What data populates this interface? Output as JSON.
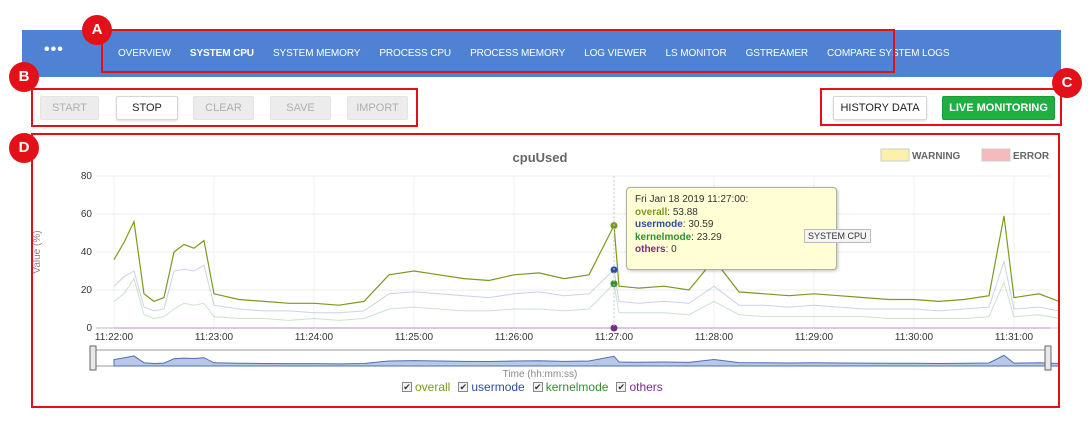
{
  "nav": {
    "more": "•••",
    "items": [
      {
        "label": "OVERVIEW",
        "active": false
      },
      {
        "label": "SYSTEM CPU",
        "active": true
      },
      {
        "label": "SYSTEM MEMORY",
        "active": false
      },
      {
        "label": "PROCESS CPU",
        "active": false
      },
      {
        "label": "PROCESS MEMORY",
        "active": false
      },
      {
        "label": "LOG VIEWER",
        "active": false
      },
      {
        "label": "LS MONITOR",
        "active": false
      },
      {
        "label": "GSTREAMER",
        "active": false
      },
      {
        "label": "COMPARE SYSTEM LOGS",
        "active": false
      }
    ]
  },
  "markers": {
    "a": "A",
    "b": "B",
    "c": "C",
    "d": "D"
  },
  "toolbar": {
    "start": "START",
    "stop": "STOP",
    "clear": "CLEAR",
    "save": "SAVE",
    "import": "IMPORT",
    "history": "HISTORY DATA",
    "live": "LIVE MONITORING"
  },
  "colors": {
    "accent": "#4f82d2",
    "annotation": "#e3101a",
    "live": "#1fae40",
    "overall": "#7a9a1e",
    "usermode": "#2a4f9c",
    "kernelmode": "#2f8f2f",
    "others": "#7b2a8a"
  },
  "chart_data": {
    "type": "line",
    "title": "cpuUsed",
    "ylabel": "Value (%)",
    "xlabel": "Time (hh:mm:ss)",
    "ylim": [
      0,
      80
    ],
    "y_ticks": [
      "0",
      "20",
      "40",
      "60",
      "80"
    ],
    "x_ticks": [
      "11:22:00",
      "11:23:00",
      "11:24:00",
      "11:25:00",
      "11:26:00",
      "11:27:00",
      "11:28:00",
      "11:29:00",
      "11:30:00",
      "11:31:00"
    ],
    "legend_top": [
      {
        "label": "WARNING",
        "color": "#fdf1a9"
      },
      {
        "label": "ERROR",
        "color": "#f8b9bd"
      }
    ],
    "x_minutes": [
      0,
      0.1,
      0.2,
      0.3,
      0.4,
      0.5,
      0.6,
      0.7,
      0.8,
      0.9,
      1.0,
      1.25,
      1.5,
      1.75,
      2.0,
      2.25,
      2.5,
      2.75,
      3.0,
      3.25,
      3.5,
      3.75,
      4.0,
      4.25,
      4.5,
      4.75,
      5.0,
      5.05,
      5.25,
      5.5,
      5.75,
      6.0,
      6.25,
      6.5,
      6.75,
      7.0,
      7.25,
      7.5,
      7.75,
      8.0,
      8.25,
      8.5,
      8.75,
      8.9,
      9.0,
      9.25,
      9.45
    ],
    "series": [
      {
        "name": "overall",
        "color": "#7a9a1e",
        "values": [
          36,
          45,
          56,
          18,
          14,
          16,
          40,
          44,
          42,
          46,
          18,
          15,
          14,
          13,
          13,
          12,
          14,
          28,
          30,
          28,
          26,
          25,
          28,
          29,
          26,
          28,
          53.88,
          22,
          21,
          22,
          20,
          36,
          19,
          18,
          17,
          18,
          17,
          16,
          15,
          15,
          14,
          15,
          17,
          59,
          16,
          18,
          14
        ]
      },
      {
        "name": "usermode",
        "color": "#2a4f9c",
        "values": [
          22,
          27,
          30,
          11,
          9,
          10,
          30,
          31,
          30,
          33,
          12,
          10,
          9,
          9,
          8,
          8,
          9,
          18,
          19,
          18,
          17,
          16,
          18,
          19,
          17,
          18,
          30.59,
          14,
          13,
          14,
          13,
          22,
          12,
          12,
          11,
          12,
          11,
          10,
          10,
          10,
          9,
          10,
          11,
          35,
          10,
          11,
          9
        ]
      },
      {
        "name": "kernelmode",
        "color": "#2f8f2f",
        "values": [
          14,
          18,
          26,
          7,
          5,
          6,
          10,
          13,
          12,
          13,
          6,
          5,
          5,
          4,
          5,
          4,
          5,
          10,
          11,
          10,
          9,
          9,
          10,
          10,
          9,
          10,
          23.29,
          8,
          8,
          8,
          7,
          14,
          7,
          6,
          6,
          6,
          6,
          6,
          5,
          5,
          5,
          5,
          6,
          24,
          6,
          7,
          5
        ]
      },
      {
        "name": "others",
        "color": "#7b2a8a",
        "values": [
          0,
          0,
          0,
          0,
          0,
          0,
          0,
          0,
          0,
          0,
          0,
          0,
          0,
          0,
          0,
          0,
          0,
          0,
          0,
          0,
          0,
          0,
          0,
          0,
          0,
          0,
          0,
          0,
          0,
          0,
          0,
          0,
          0,
          0,
          0,
          0,
          0,
          0,
          0,
          0,
          0,
          0,
          0,
          0,
          0,
          0,
          0
        ]
      }
    ],
    "tooltip": {
      "time": "Fri Jan 18 2019 11:27:00:",
      "lines": [
        {
          "name": "overall",
          "value": "53.88"
        },
        {
          "name": "usermode",
          "value": "30.59"
        },
        {
          "name": "kernelmode",
          "value": "23.29"
        },
        {
          "name": "others",
          "value": "0"
        }
      ]
    },
    "tag": "SYSTEM CPU"
  },
  "legend_bottom": [
    {
      "label": "overall",
      "checked": true
    },
    {
      "label": "usermode",
      "checked": true
    },
    {
      "label": "kernelmode",
      "checked": true
    },
    {
      "label": "others",
      "checked": true
    }
  ]
}
